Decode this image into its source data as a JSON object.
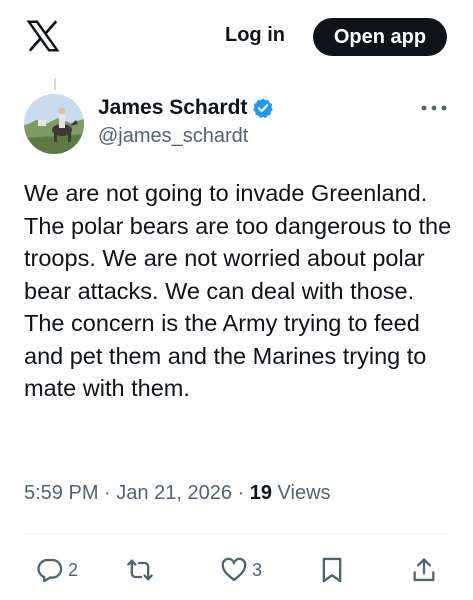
{
  "header": {
    "login_label": "Log in",
    "open_app_label": "Open app"
  },
  "tweet": {
    "author_name": "James Schardt",
    "author_handle": "@james_schardt",
    "verified": true,
    "text": "We are not going to invade Greenland. The polar bears are too dangerous to the troops. We are not worried about polar bear attacks. We can deal with those. The concern is the Army trying to feed and pet them and the Marines trying to mate with them.",
    "time": "5:59 PM",
    "date": "Jan 21, 2026",
    "views_count": "19",
    "views_label": "Views",
    "separator": "·"
  },
  "actions": {
    "replies": "2",
    "reposts": "",
    "likes": "3"
  },
  "colors": {
    "verified_badge": "#1d9bf0",
    "secondary_text": "#536471",
    "primary_text": "#0f1419",
    "action_icon": "#536471"
  },
  "icons": [
    "x-logo-icon",
    "verified-badge-icon",
    "more-icon",
    "reply-icon",
    "repost-icon",
    "like-icon",
    "bookmark-icon",
    "share-icon"
  ]
}
